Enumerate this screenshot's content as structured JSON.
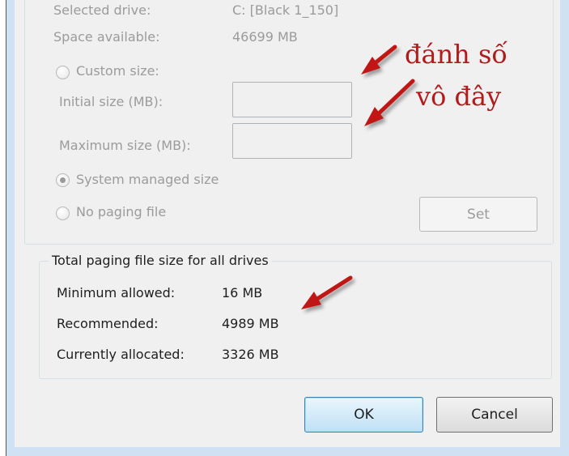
{
  "drive": {
    "selected_label": "Selected drive:",
    "selected_value": "C:  [Black 1_150]",
    "space_label": "Space available:",
    "space_value": "46699 MB"
  },
  "options": {
    "custom_size": "Custom size:",
    "initial_size": "Initial size (MB):",
    "maximum_size": "Maximum size (MB):",
    "system_managed": "System managed size",
    "no_paging": "No paging file",
    "set_label": "Set"
  },
  "totals": {
    "title": "Total paging file size for all drives",
    "minimum_label": "Minimum allowed:",
    "minimum_value": "16 MB",
    "recommended_label": "Recommended:",
    "recommended_value": "4989 MB",
    "allocated_label": "Currently allocated:",
    "allocated_value": "3326 MB"
  },
  "buttons": {
    "ok": "OK",
    "cancel": "Cancel"
  },
  "annotation": {
    "line1": "đánh số",
    "line2": "vô đây",
    "color": "#b01c1c"
  },
  "state": {
    "selected_option": "system_managed"
  }
}
